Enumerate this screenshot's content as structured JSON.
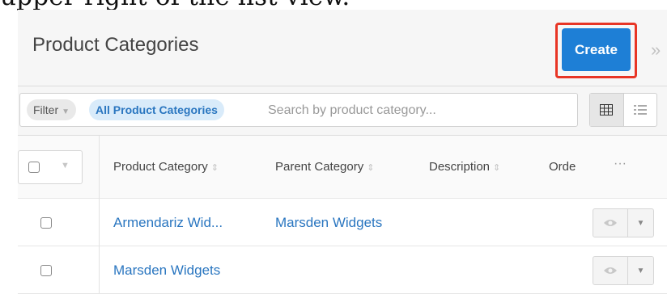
{
  "caption": "upper right of the list view.",
  "header": {
    "title": "Product Categories",
    "create_label": "Create",
    "collapse_icon": "double-chevron-right-icon"
  },
  "filter_bar": {
    "filter_label": "Filter",
    "filter_tag": "All Product Categories",
    "search_placeholder": "Search by product category...",
    "view_icons": [
      "grid-view-icon",
      "list-view-icon"
    ]
  },
  "table": {
    "columns": [
      "Product Category",
      "Parent Category",
      "Description",
      "Orde"
    ],
    "actions_menu": "···",
    "rows": [
      {
        "product_category": "Armendariz Wid...",
        "parent_category": "Marsden Widgets",
        "description": ""
      },
      {
        "product_category": "Marsden Widgets",
        "parent_category": "",
        "description": ""
      }
    ]
  },
  "colors": {
    "accent": "#1e7fd6",
    "highlight": "#e83525",
    "link": "#2a76c0"
  }
}
